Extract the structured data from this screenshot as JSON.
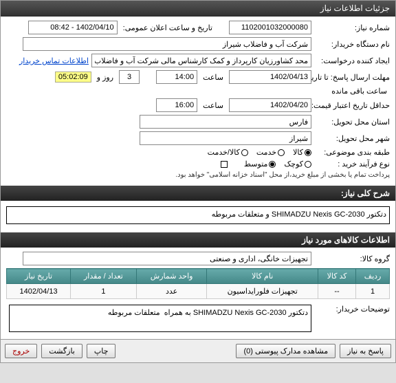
{
  "header": {
    "title": "جزئیات اطلاعات نیاز"
  },
  "form": {
    "need_no_label": "شماره نیاز:",
    "need_no": "1102001032000080",
    "announce_label": "تاریخ و ساعت اعلان عمومی:",
    "announce_value": "1402/04/10 - 08:42",
    "buyer_label": "نام دستگاه خریدار:",
    "buyer_value": "شرکت آب و فاضلاب شیراز",
    "creator_label": "ایجاد کننده درخواست:",
    "creator_value": "محد کشاورزیان کارپرداز و کمک کارشناس مالی شرکت آب و فاضلاب شیراز",
    "contact_link": "اطلاعات تماس خریدار",
    "deadline_send_label": "مهلت ارسال پاسخ: تا تاریخ:",
    "deadline_send_date": "1402/04/13",
    "time_label": "ساعت",
    "deadline_send_time": "14:00",
    "days_remain": "3",
    "days_remain_label": "روز و",
    "countdown": "05:02:09",
    "countdown_label": "ساعت باقی مانده",
    "validity_label": "حداقل تاریخ اعتبار قیمت: تا تاریخ:",
    "validity_date": "1402/04/20",
    "validity_time": "16:00",
    "province_label": "استان محل تحویل:",
    "province_value": "فارس",
    "city_label": "شهر محل تحویل:",
    "city_value": "شیراز",
    "category_label": "طبقه بندی موضوعی:",
    "cat_goods": "کالا",
    "cat_service": "خدمت",
    "cat_goods_service": "کالا/خدمت",
    "process_label": "نوع فرآیند خرید :",
    "proc_small": "کوچک",
    "proc_medium": "متوسط",
    "payment_note": "پرداخت تمام یا بخشی از مبلغ خرید،از محل \"اسناد خزانه اسلامی\" خواهد بود."
  },
  "sections": {
    "general_desc": "شرح کلی نیاز:",
    "general_desc_value": "دتکتور SHIMADZU Nexis GC-2030 و متعلقات مربوطه",
    "goods_info": "اطلاعات کالاهای مورد نیاز",
    "goods_group_label": "گروه کالا:",
    "goods_group_value": "تجهیزات خانگی، اداری و صنعتی",
    "buyer_notes_label": "توضیحات خریدار:",
    "buyer_notes_value": "دتکتور SHIMADZU Nexis GC-2030 به همراه  متعلقات مربوطه"
  },
  "table": {
    "headers": [
      "ردیف",
      "کد کالا",
      "نام کالا",
      "واحد شمارش",
      "تعداد / مقدار",
      "تاریخ نیاز"
    ],
    "rows": [
      {
        "idx": "1",
        "code": "--",
        "name": "تجهیزات فلورایداسیون",
        "unit": "عدد",
        "qty": "1",
        "date": "1402/04/13"
      }
    ]
  },
  "footer": {
    "reply": "پاسخ به نیاز",
    "attachments": "مشاهده مدارک پیوستی  (0)",
    "print": "چاپ",
    "back": "بازگشت",
    "exit": "خروج"
  }
}
